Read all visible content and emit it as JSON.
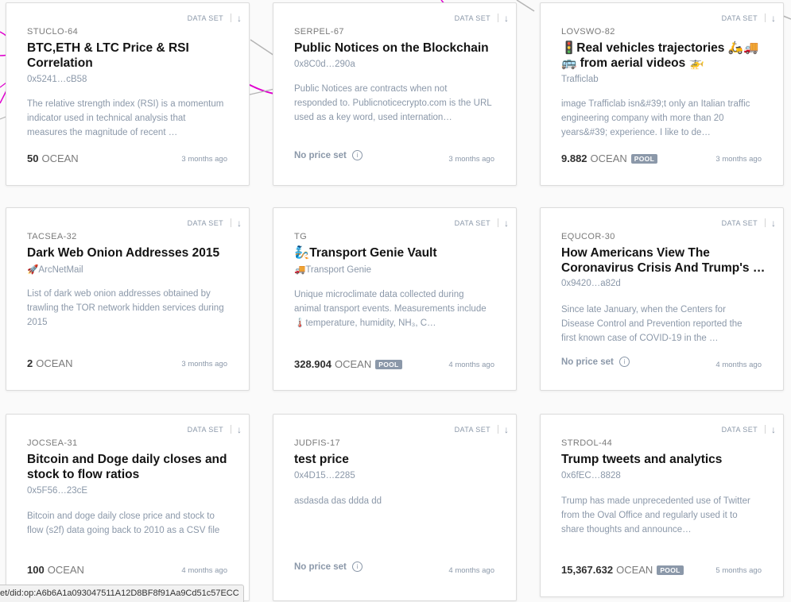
{
  "cards": [
    {
      "type": "DATA SET",
      "symbol": "STUCLO-64",
      "title": "BTC,ETH & LTC Price & RSI Correlation",
      "owner": "0x5241…cB58",
      "description": "The relative strength index (RSI) is a momentum indicator used in technical analysis that measures the magnitude of recent …",
      "price": "50",
      "unit": "OCEAN",
      "pool": "",
      "no_price": "",
      "date": "3 months ago"
    },
    {
      "type": "DATA SET",
      "symbol": "SERPEL-67",
      "title": "Public Notices on the Blockchain",
      "owner": "0x8C0d…290a",
      "description": "Public Notices are contracts when not responded to. Publicnoticecrypto.com is the URL used as a key word, used internation…",
      "price": "",
      "unit": "",
      "pool": "",
      "no_price": "No price set",
      "date": "3 months ago"
    },
    {
      "type": "DATA SET",
      "symbol": "LOVSWO-82",
      "title": "🚦Real vehicles trajectories 🛵🚚🚌 from aerial videos 🚁analyzed…",
      "owner": "Trafficlab",
      "description": "image Trafficlab isn&#39;t only an Italian traffic engineering company with more than 20 years&#39; experience. I like to de…",
      "price": "9.882",
      "unit": "OCEAN",
      "pool": "POOL",
      "no_price": "",
      "date": "3 months ago"
    },
    {
      "type": "DATA SET",
      "symbol": "TACSEA-32",
      "title": "Dark Web Onion Addresses 2015",
      "owner": "🚀ArcNetMail",
      "description": "List of dark web onion addresses obtained by trawling the TOR network hidden services during 2015",
      "price": "2",
      "unit": "OCEAN",
      "pool": "",
      "no_price": "",
      "date": "3 months ago"
    },
    {
      "type": "DATA SET",
      "symbol": "TG",
      "title": "🧞Transport Genie Vault",
      "owner": "🚚Transport Genie",
      "description": "Unique microclimate data collected during animal transport events. Measurements include 🌡️temperature, humidity, NH₃, C…",
      "price": "328.904",
      "unit": "OCEAN",
      "pool": "POOL",
      "no_price": "",
      "date": "4 months ago"
    },
    {
      "type": "DATA SET",
      "symbol": "EQUCOR-30",
      "title": "How Americans View The Coronavirus Crisis And Trump's …",
      "owner": "0x9420…a82d",
      "description": "Since late January, when the Centers for Disease Control and Prevention reported the first known case of COVID-19 in the …",
      "price": "",
      "unit": "",
      "pool": "",
      "no_price": "No price set",
      "date": "4 months ago"
    },
    {
      "type": "DATA SET",
      "symbol": "JOCSEA-31",
      "title": "Bitcoin and Doge daily closes and stock to flow ratios",
      "owner": "0x5F56…23cE",
      "description": "Bitcoin and doge daily close price and stock to flow (s2f) data going back to 2010 as a CSV file",
      "price": "100",
      "unit": "OCEAN",
      "pool": "",
      "no_price": "",
      "date": "4 months ago"
    },
    {
      "type": "DATA SET",
      "symbol": "JUDFIS-17",
      "title": "test price",
      "owner": "0x4D15…2285",
      "description": "asdasda das ddda dd",
      "price": "",
      "unit": "",
      "pool": "",
      "no_price": "No price set",
      "date": "4 months ago"
    },
    {
      "type": "DATA SET",
      "symbol": "STRDOL-44",
      "title": "Trump tweets and analytics",
      "owner": "0x6fEC…8828",
      "description": "Trump has made unprecedented use of Twitter from the Oval Office and regularly used it to share thoughts and announce…",
      "price": "15,367.632",
      "unit": "OCEAN",
      "pool": "POOL",
      "no_price": "",
      "date": "5 months ago"
    }
  ],
  "status_bar": {
    "url": "et/did:op:A6b6A1a093047511A12D8BF8f91Aa9Cd51c57ECC"
  },
  "colors": {
    "accent_line": "#e000cf",
    "muted": "#8b98a9",
    "line_gray": "#b4b4b4"
  }
}
